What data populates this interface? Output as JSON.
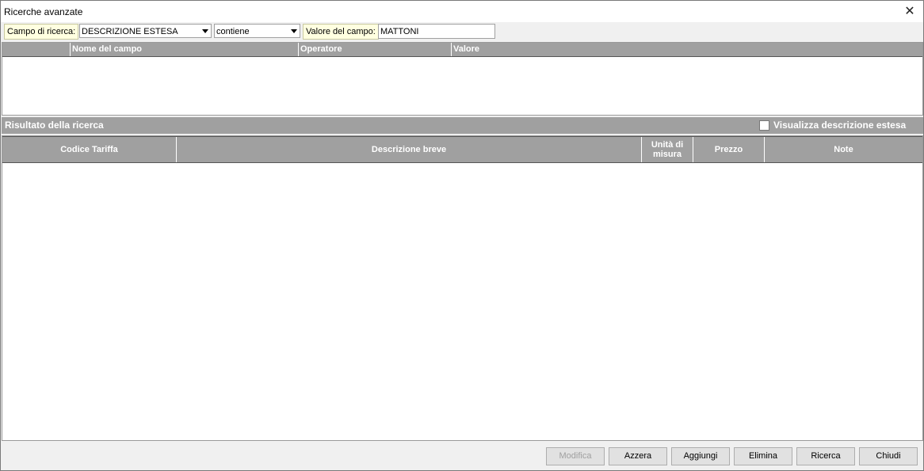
{
  "window": {
    "title": "Ricerche avanzate"
  },
  "search": {
    "field_label": "Campo di ricerca:",
    "field_value": "DESCRIZIONE ESTESA",
    "operator_value": "contiene",
    "value_label": "Valore del campo:",
    "value_text": "MATTONI"
  },
  "criteria_grid": {
    "columns": [
      "",
      "Nome del campo",
      "Operatore",
      "Valore"
    ]
  },
  "results": {
    "title": "Risultato della ricerca",
    "extended_checkbox_label": "Visualizza descrizione estesa",
    "extended_checked": false,
    "columns": [
      "Codice Tariffa",
      "Descrizione breve",
      "Unità di misura",
      "Prezzo",
      "Note"
    ]
  },
  "buttons": {
    "modifica": "Modifica",
    "azzera": "Azzera",
    "aggiungi": "Aggiungi",
    "elimina": "Elimina",
    "ricerca": "Ricerca",
    "chiudi": "Chiudi"
  },
  "icons": {
    "close": "close-icon",
    "dropdown": "chevron-down-icon"
  }
}
